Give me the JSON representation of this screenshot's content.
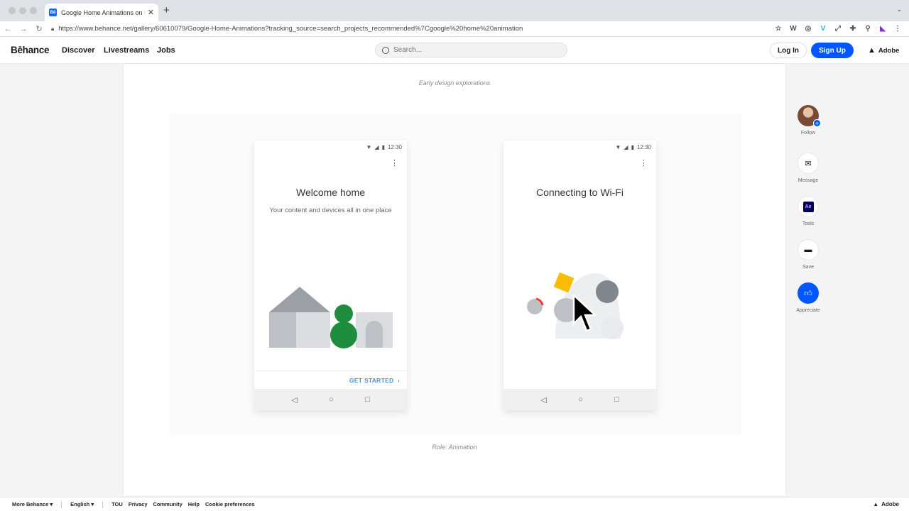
{
  "browser": {
    "tab_title": "Google Home Animations on Behance",
    "favicon_text": "Bē",
    "url": "https://www.behance.net/gallery/60610079/Google-Home-Animations?tracking_source=search_projects_recommended%7Cgoogle%20home%20animation"
  },
  "header": {
    "logo": "Bēhance",
    "nav": [
      "Discover",
      "Livestreams",
      "Jobs"
    ],
    "search_placeholder": "Search...",
    "login": "Log In",
    "signup": "Sign Up",
    "adobe": "Adobe"
  },
  "content": {
    "top_caption": "Early design explorations",
    "bottom_caption": "Role:  Animation",
    "phone1": {
      "time": "12:30",
      "title": "Welcome home",
      "subtitle": "Your content and devices all in one place",
      "cta": "GET STARTED"
    },
    "phone2": {
      "time": "12:30",
      "title": "Connecting to Wi-Fi"
    }
  },
  "side": {
    "follow": "Follow",
    "message": "Message",
    "tools": "Tools",
    "tools_badge": "Ae",
    "save": "Save",
    "appreciate": "Appreciate"
  },
  "footer": {
    "more": "More Behance",
    "language": "English",
    "links": [
      "TOU",
      "Privacy",
      "Community",
      "Help",
      "Cookie preferences"
    ],
    "adobe": "Adobe"
  },
  "colors": {
    "brand_blue": "#0057ff",
    "illustration_green": "#1e8e3e",
    "illustration_yellow": "#fbbc04"
  }
}
